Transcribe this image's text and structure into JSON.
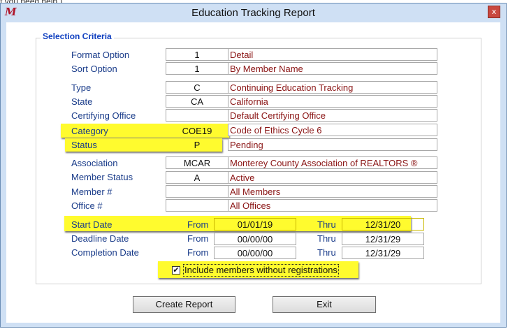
{
  "behind_text": "f you need help.)",
  "window": {
    "title": "Education Tracking Report",
    "app_icon": "M",
    "close_glyph": "x"
  },
  "legend": "Selection Criteria",
  "rows": {
    "format": {
      "label": "Format Option",
      "code": "1",
      "desc": "Detail"
    },
    "sort": {
      "label": "Sort Option",
      "code": "1",
      "desc": "By Member Name"
    },
    "type": {
      "label": "Type",
      "code": "C",
      "desc": "Continuing Education Tracking"
    },
    "state": {
      "label": "State",
      "code": "CA",
      "desc": "California"
    },
    "office": {
      "label": "Certifying Office",
      "code": "",
      "desc": "Default Certifying Office"
    },
    "category": {
      "label": "Category",
      "code": "COE19",
      "desc": "Code of Ethics Cycle 6"
    },
    "status": {
      "label": "Status",
      "code": "P",
      "desc": "Pending"
    },
    "association": {
      "label": "Association",
      "code": "MCAR",
      "desc": "Monterey County Association of REALTORS ®"
    },
    "member_status": {
      "label": "Member Status",
      "code": "A",
      "desc": "Active"
    },
    "member_no": {
      "label": "Member #",
      "code": "",
      "desc": "All Members"
    },
    "office_no": {
      "label": "Office #",
      "code": "",
      "desc": "All Offices"
    }
  },
  "dates": {
    "from_label": "From",
    "thru_label": "Thru",
    "start": {
      "label": "Start Date",
      "from": "01/01/19",
      "thru": "12/31/20"
    },
    "deadline": {
      "label": "Deadline Date",
      "from": "00/00/00",
      "thru": "12/31/29"
    },
    "completion": {
      "label": "Completion Date",
      "from": "00/00/00",
      "thru": "12/31/29"
    }
  },
  "include_checkbox": {
    "label": "Include members without registrations",
    "checked": true,
    "check_glyph": "✔"
  },
  "buttons": {
    "create": "Create Report",
    "exit": "Exit"
  },
  "colors": {
    "highlight": "#fffb2e",
    "label_blue": "#1a3c8a",
    "desc_red": "#8a1414",
    "legend_blue": "#1040c0"
  }
}
